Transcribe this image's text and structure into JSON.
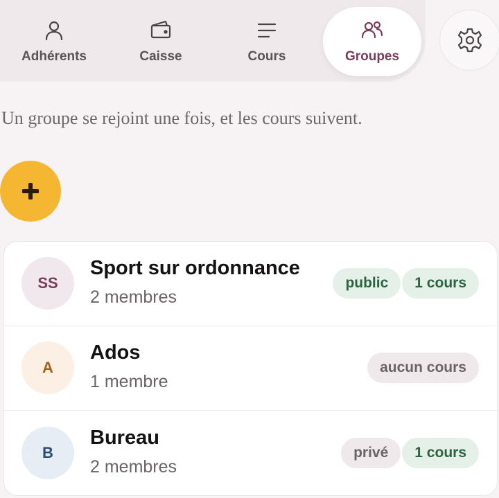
{
  "nav": {
    "tabs": [
      {
        "label": "Adhérents",
        "icon": "user-icon"
      },
      {
        "label": "Caisse",
        "icon": "wallet-icon"
      },
      {
        "label": "Cours",
        "icon": "menu-lines-icon"
      },
      {
        "label": "Groupes",
        "icon": "users-icon",
        "active": true
      }
    ],
    "settings_icon": "gear-icon"
  },
  "intro": "Un groupe se rejoint une fois, et les cours suivent.",
  "add_button": {
    "icon": "plus-icon",
    "label": "+"
  },
  "groups": [
    {
      "initials": "SS",
      "name": "Sport sur ordonnance",
      "members": "2 membres",
      "avatar_bg": "#f1e8ed",
      "avatar_fg": "#7a3e5c",
      "badges": [
        {
          "text": "public",
          "style": "green"
        },
        {
          "text": "1 cours",
          "style": "green"
        }
      ]
    },
    {
      "initials": "A",
      "name": "Ados",
      "members": "1 membre",
      "avatar_bg": "#fcefe3",
      "avatar_fg": "#a0601e",
      "badges": [
        {
          "text": "aucun cours",
          "style": "gray"
        }
      ]
    },
    {
      "initials": "B",
      "name": "Bureau",
      "members": "2 membres",
      "avatar_bg": "#e6edf5",
      "avatar_fg": "#2e4d72",
      "badges": [
        {
          "text": "privé",
          "style": "gray"
        },
        {
          "text": "1 cours",
          "style": "green"
        }
      ]
    }
  ],
  "colors": {
    "accent": "#7a3e5c",
    "add_button": "#f5b731",
    "green_badge_bg": "#e5f1e8",
    "green_badge_fg": "#2c6340",
    "gray_badge_bg": "#efe9eb"
  }
}
